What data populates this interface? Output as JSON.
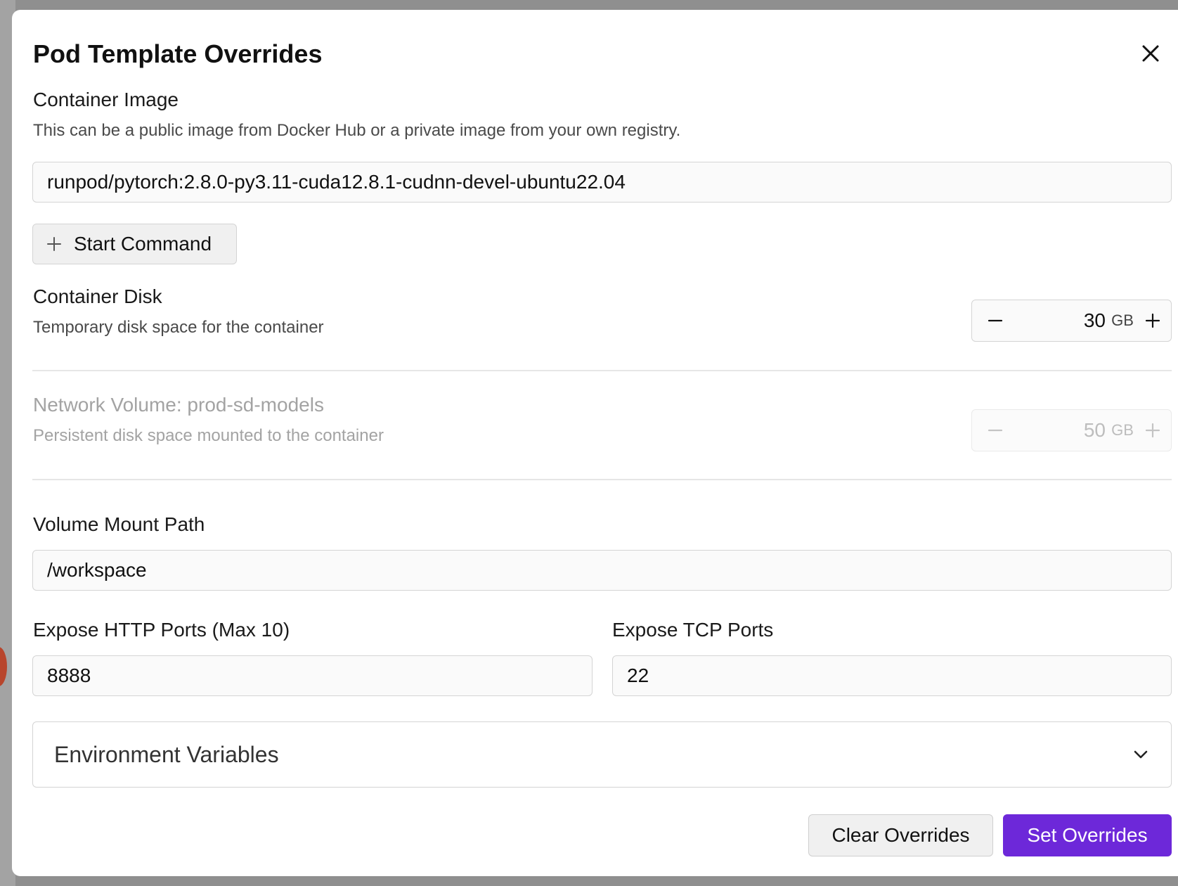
{
  "modal": {
    "title": "Pod Template Overrides",
    "close_icon": "close-icon"
  },
  "container_image": {
    "label": "Container Image",
    "help": "This can be a public image from Docker Hub or a private image from your own registry.",
    "value": "runpod/pytorch:2.8.0-py3.11-cuda12.8.1-cudnn-devel-ubuntu22.04"
  },
  "start_command": {
    "label": "Start Command",
    "icon": "plus-icon"
  },
  "container_disk": {
    "label": "Container Disk",
    "help": "Temporary disk space for the container",
    "value": "30",
    "unit": "GB",
    "disabled": false
  },
  "network_volume": {
    "label": "Network Volume: prod-sd-models",
    "help": "Persistent disk space mounted to the container",
    "value": "50",
    "unit": "GB",
    "disabled": true
  },
  "volume_mount_path": {
    "label": "Volume Mount Path",
    "value": "/workspace"
  },
  "http_ports": {
    "label": "Expose HTTP Ports (Max 10)",
    "value": "8888"
  },
  "tcp_ports": {
    "label": "Expose TCP Ports",
    "value": "22"
  },
  "env_vars": {
    "label": "Environment Variables",
    "icon": "chevron-down-icon",
    "expanded": false
  },
  "footer": {
    "clear_label": "Clear Overrides",
    "set_label": "Set Overrides"
  },
  "colors": {
    "primary": "#6d28d9",
    "text": "#111111",
    "muted": "#4a4a4a",
    "disabled": "#a3a3a3",
    "border": "#d4d4d4"
  }
}
